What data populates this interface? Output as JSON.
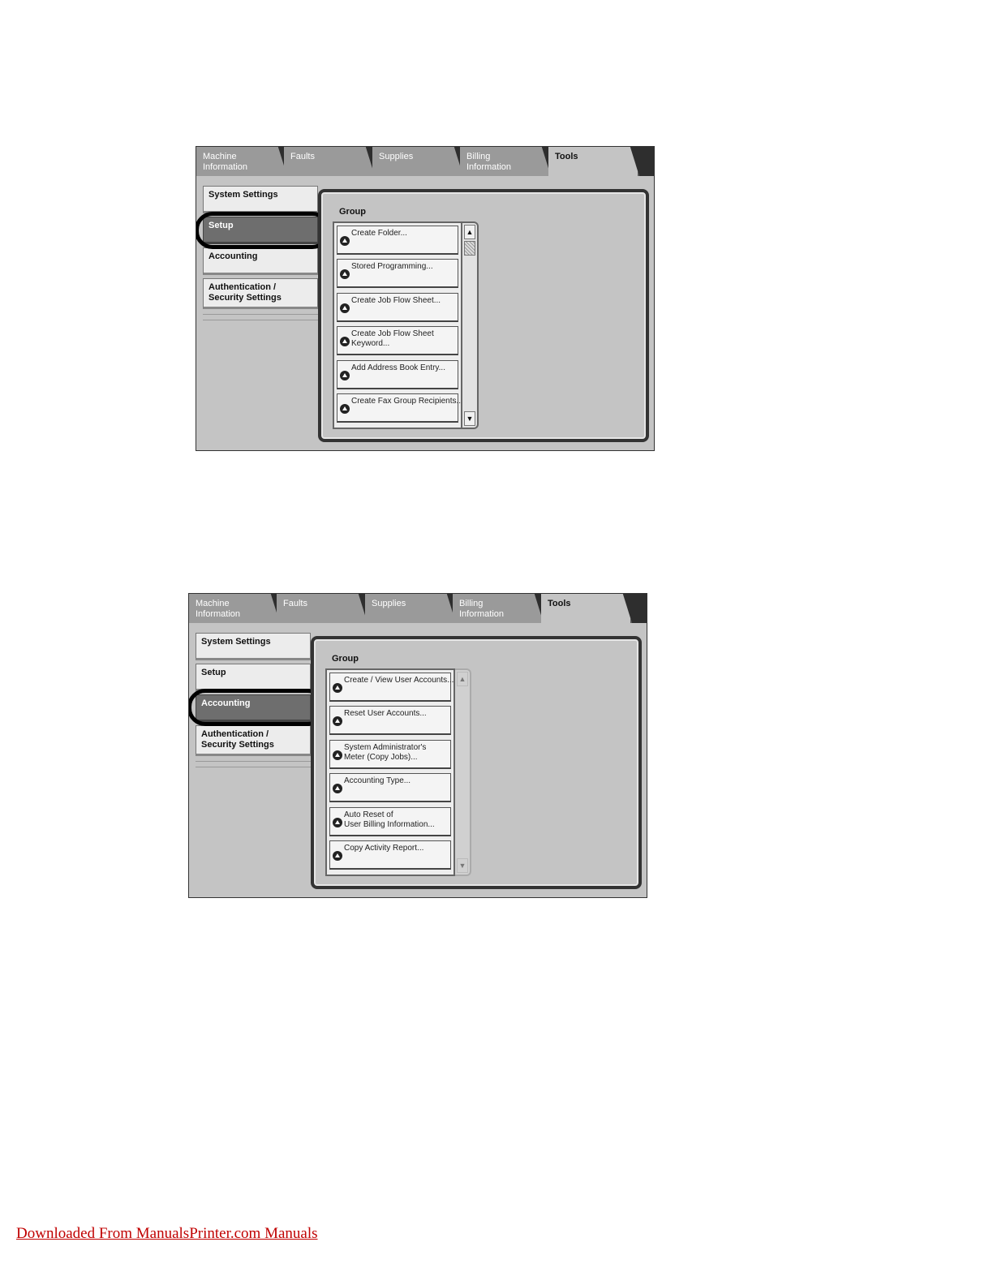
{
  "screen1": {
    "tabs": [
      {
        "line1": "Machine",
        "line2": "Information"
      },
      {
        "line1": "Faults",
        "line2": ""
      },
      {
        "line1": "Supplies",
        "line2": ""
      },
      {
        "line1": "Billing",
        "line2": "Information"
      },
      {
        "line1": "Tools",
        "line2": ""
      }
    ],
    "side": [
      {
        "line1": "System Settings",
        "line2": ""
      },
      {
        "line1": "Setup",
        "line2": ""
      },
      {
        "line1": "Accounting",
        "line2": ""
      },
      {
        "line1": "Authentication /",
        "line2": "Security Settings"
      }
    ],
    "group_label": "Group",
    "items": [
      {
        "line1": "Create Folder...",
        "line2": ""
      },
      {
        "line1": "Stored Programming...",
        "line2": ""
      },
      {
        "line1": "Create Job Flow Sheet...",
        "line2": ""
      },
      {
        "line1": "Create Job Flow Sheet",
        "line2": "Keyword..."
      },
      {
        "line1": "Add Address Book Entry...",
        "line2": ""
      },
      {
        "line1": "Create Fax Group Recipients...",
        "line2": ""
      }
    ],
    "scroll_up": "▲",
    "scroll_down": "▼"
  },
  "screen2": {
    "tabs": [
      {
        "line1": "Machine",
        "line2": "Information"
      },
      {
        "line1": "Faults",
        "line2": ""
      },
      {
        "line1": "Supplies",
        "line2": ""
      },
      {
        "line1": "Billing",
        "line2": "Information"
      },
      {
        "line1": "Tools",
        "line2": ""
      }
    ],
    "side": [
      {
        "line1": "System Settings",
        "line2": ""
      },
      {
        "line1": "Setup",
        "line2": ""
      },
      {
        "line1": "Accounting",
        "line2": ""
      },
      {
        "line1": "Authentication /",
        "line2": "Security Settings"
      }
    ],
    "group_label": "Group",
    "items": [
      {
        "line1": "Create / View User Accounts...",
        "line2": ""
      },
      {
        "line1": "Reset User Accounts...",
        "line2": ""
      },
      {
        "line1": "System Administrator's",
        "line2": "Meter (Copy Jobs)..."
      },
      {
        "line1": "Accounting Type...",
        "line2": ""
      },
      {
        "line1": "Auto Reset of",
        "line2": "User Billing Information..."
      },
      {
        "line1": "Copy Activity Report...",
        "line2": ""
      }
    ],
    "scroll_up": "▲",
    "scroll_down": "▼"
  },
  "footer": {
    "link_text": "Downloaded From ManualsPrinter.com Manuals"
  }
}
